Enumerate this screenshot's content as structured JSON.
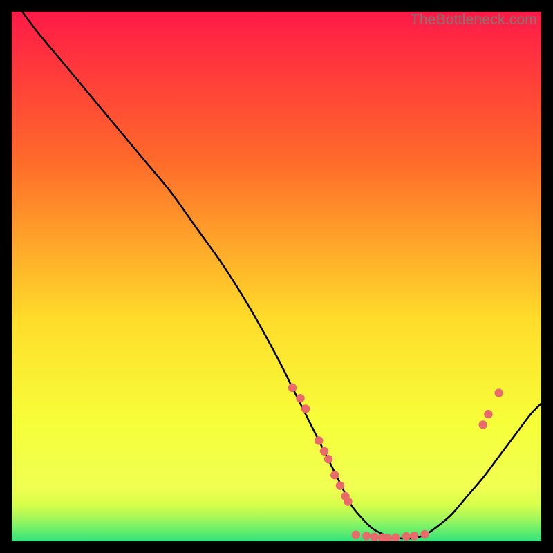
{
  "watermark": "TheBottleneck.com",
  "colors": {
    "bg": "#000000",
    "curve": "#000000",
    "dot_fill": "#e86a6a",
    "dot_stroke": "#c64d4d",
    "grad_top": "#ff1a47",
    "grad_upper_mid": "#ff6a2a",
    "grad_mid": "#ffdc2a",
    "grad_lower_mid": "#f6ff3a",
    "grad_low": "#f0ff52",
    "grad_band1": "#d8ff4a",
    "grad_band2": "#a8f75a",
    "grad_band3": "#73f06a",
    "grad_bottom": "#2fe47a"
  },
  "chart_data": {
    "type": "line",
    "title": "",
    "xlabel": "",
    "ylabel": "",
    "xlim": [
      0,
      100
    ],
    "ylim": [
      0,
      100
    ],
    "series": [
      {
        "name": "curve",
        "x": [
          2,
          5,
          10,
          15,
          20,
          25,
          30,
          35,
          40,
          45,
          50,
          53,
          56,
          59,
          62,
          64,
          66,
          68,
          70,
          72,
          74,
          76,
          78,
          80,
          83,
          86,
          89,
          92,
          95,
          98,
          100
        ],
        "y": [
          100,
          96,
          90,
          84,
          78,
          72,
          66,
          59,
          52,
          44,
          35,
          29,
          23,
          17,
          11,
          7,
          4.5,
          2.5,
          1.4,
          0.8,
          0.5,
          0.6,
          1.2,
          2.5,
          5,
          8.5,
          12,
          16,
          20,
          24,
          26
        ]
      }
    ],
    "dots": [
      {
        "x": 53,
        "y": 29
      },
      {
        "x": 54.5,
        "y": 27
      },
      {
        "x": 55.5,
        "y": 25
      },
      {
        "x": 58,
        "y": 19
      },
      {
        "x": 59,
        "y": 17
      },
      {
        "x": 59.8,
        "y": 15.5
      },
      {
        "x": 61,
        "y": 12.5
      },
      {
        "x": 62,
        "y": 10.5
      },
      {
        "x": 63,
        "y": 8.5
      },
      {
        "x": 63.5,
        "y": 7.5
      },
      {
        "x": 65,
        "y": 1.2
      },
      {
        "x": 67,
        "y": 1.0
      },
      {
        "x": 68.5,
        "y": 0.8
      },
      {
        "x": 70,
        "y": 0.7
      },
      {
        "x": 71,
        "y": 0.6
      },
      {
        "x": 72.5,
        "y": 0.7
      },
      {
        "x": 74.5,
        "y": 0.9
      },
      {
        "x": 76,
        "y": 1.0
      },
      {
        "x": 78,
        "y": 1.3
      },
      {
        "x": 89,
        "y": 22
      },
      {
        "x": 90,
        "y": 24
      },
      {
        "x": 92,
        "y": 28
      }
    ]
  }
}
